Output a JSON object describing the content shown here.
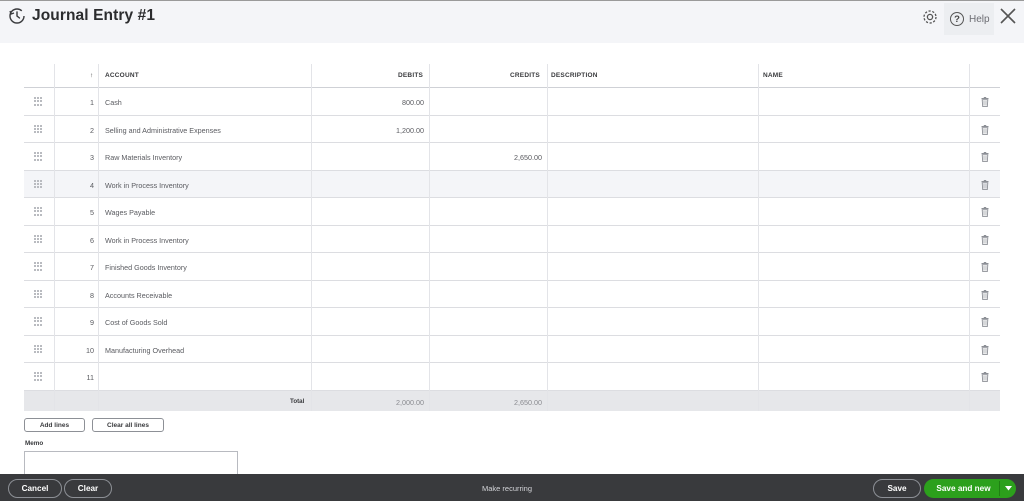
{
  "header": {
    "title": "Journal Entry #1",
    "help_label": "Help"
  },
  "table": {
    "columns": {
      "sort": "↑",
      "account": "ACCOUNT",
      "debits": "DEBITS",
      "credits": "CREDITS",
      "description": "DESCRIPTION",
      "name": "NAME"
    },
    "rows": [
      {
        "num": "1",
        "account": "Cash",
        "debit": "800.00",
        "credit": "",
        "highlighted": false
      },
      {
        "num": "2",
        "account": "Selling and Administrative Expenses",
        "debit": "1,200.00",
        "credit": "",
        "highlighted": false
      },
      {
        "num": "3",
        "account": "Raw Materials Inventory",
        "debit": "",
        "credit": "2,650.00",
        "highlighted": false
      },
      {
        "num": "4",
        "account": "Work in Process Inventory",
        "debit": "",
        "credit": "",
        "highlighted": true
      },
      {
        "num": "5",
        "account": "Wages Payable",
        "debit": "",
        "credit": "",
        "highlighted": false
      },
      {
        "num": "6",
        "account": "Work in Process Inventory",
        "debit": "",
        "credit": "",
        "highlighted": false
      },
      {
        "num": "7",
        "account": "Finished Goods Inventory",
        "debit": "",
        "credit": "",
        "highlighted": false
      },
      {
        "num": "8",
        "account": "Accounts Receivable",
        "debit": "",
        "credit": "",
        "highlighted": false
      },
      {
        "num": "9",
        "account": "Cost of Goods Sold",
        "debit": "",
        "credit": "",
        "highlighted": false
      },
      {
        "num": "10",
        "account": "Manufacturing Overhead",
        "debit": "",
        "credit": "",
        "highlighted": false
      },
      {
        "num": "11",
        "account": "",
        "debit": "",
        "credit": "",
        "highlighted": false
      }
    ],
    "total": {
      "label": "Total",
      "debits": "2,000.00",
      "credits": "2,650.00"
    }
  },
  "actions": {
    "add_lines": "Add lines",
    "clear_all_lines": "Clear all lines",
    "memo_label": "Memo",
    "memo_value": ""
  },
  "footer": {
    "cancel": "Cancel",
    "clear": "Clear",
    "make_recurring": "Make recurring",
    "save": "Save",
    "save_and_new": "Save and new"
  },
  "colors": {
    "primary_green": "#2ca01c",
    "footer_bg": "#393a3d",
    "header_bg": "#f4f5f8"
  },
  "icons": [
    "history-icon",
    "gear-icon",
    "help-icon",
    "close-icon",
    "drag-handle-icon",
    "trash-icon",
    "caret-down-icon"
  ]
}
